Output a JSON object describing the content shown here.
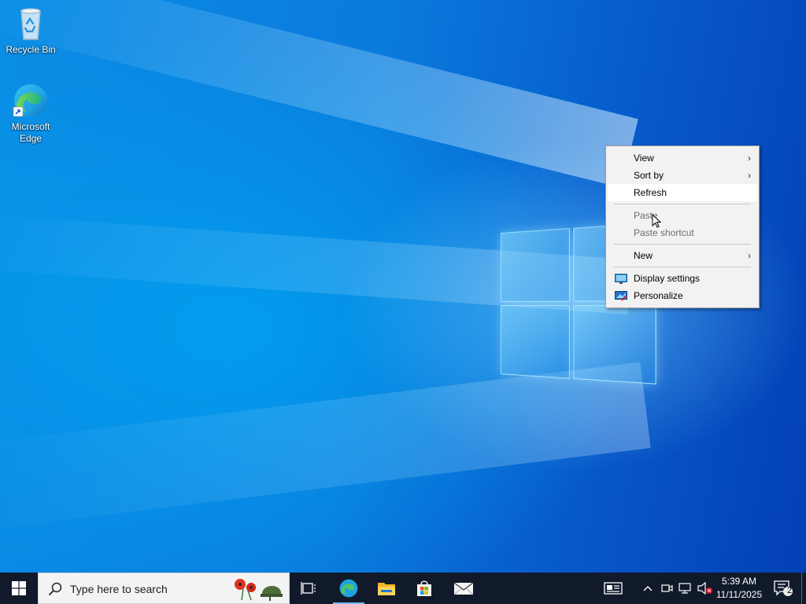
{
  "desktop": {
    "icons": [
      {
        "label": "Recycle Bin",
        "icon": "recycle-bin-icon"
      },
      {
        "label": "Microsoft Edge",
        "icon": "edge-icon"
      }
    ]
  },
  "context_menu": {
    "items": [
      {
        "label": "View",
        "submenu": true,
        "enabled": true
      },
      {
        "label": "Sort by",
        "submenu": true,
        "enabled": true
      },
      {
        "label": "Refresh",
        "submenu": false,
        "enabled": true,
        "highlighted": true
      },
      {
        "label": "Paste",
        "submenu": false,
        "enabled": false
      },
      {
        "label": "Paste shortcut",
        "submenu": false,
        "enabled": false
      },
      {
        "label": "New",
        "submenu": true,
        "enabled": true
      },
      {
        "label": "Display settings",
        "submenu": false,
        "enabled": true,
        "icon": "display-settings-icon"
      },
      {
        "label": "Personalize",
        "submenu": false,
        "enabled": true,
        "icon": "personalize-icon"
      }
    ],
    "arrow_glyph": "›"
  },
  "taskbar": {
    "search_placeholder": "Type here to search",
    "pinned": [
      "task-view-icon",
      "edge-icon",
      "file-explorer-icon",
      "microsoft-store-icon",
      "mail-icon"
    ],
    "tray": {
      "time": "5:39 AM",
      "date": "11/11/2025",
      "notification_count": "2"
    }
  },
  "colors": {
    "taskbar": "#101a2b",
    "menu_bg": "#f2f2f2",
    "menu_hover": "#ffffff",
    "disabled_text": "#6d6d6d"
  }
}
